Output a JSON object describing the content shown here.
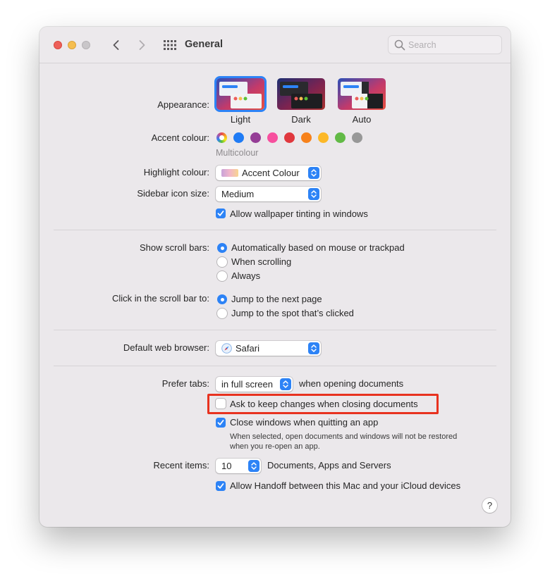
{
  "window": {
    "title": "General",
    "search_placeholder": "Search"
  },
  "appearance": {
    "label": "Appearance:",
    "options": [
      {
        "label": "Light",
        "selected": true
      },
      {
        "label": "Dark",
        "selected": false
      },
      {
        "label": "Auto",
        "selected": false
      }
    ]
  },
  "accent": {
    "label": "Accent colour:",
    "selected_name": "Multicolour",
    "colors": [
      "multicolour",
      "#1f7bf5",
      "#953d96",
      "#f74f9e",
      "#e0383e",
      "#f7821b",
      "#fcb827",
      "#62ba46",
      "#989898"
    ]
  },
  "highlight": {
    "label": "Highlight colour:",
    "value": "Accent Colour"
  },
  "sidebar_icon": {
    "label": "Sidebar icon size:",
    "value": "Medium"
  },
  "wallpaper_tinting": {
    "label": "Allow wallpaper tinting in windows",
    "checked": true
  },
  "scroll_bars": {
    "label": "Show scroll bars:",
    "options": [
      {
        "label": "Automatically based on mouse or trackpad",
        "selected": true
      },
      {
        "label": "When scrolling",
        "selected": false
      },
      {
        "label": "Always",
        "selected": false
      }
    ]
  },
  "scroll_click": {
    "label": "Click in the scroll bar to:",
    "options": [
      {
        "label": "Jump to the next page",
        "selected": true
      },
      {
        "label": "Jump to the spot that’s clicked",
        "selected": false
      }
    ]
  },
  "browser": {
    "label": "Default web browser:",
    "value": "Safari"
  },
  "prefer_tabs": {
    "label": "Prefer tabs:",
    "value": "in full screen",
    "suffix": "when opening documents"
  },
  "ask_keep_changes": {
    "label": "Ask to keep changes when closing documents",
    "checked": false
  },
  "close_windows": {
    "label": "Close windows when quitting an app",
    "checked": true,
    "note_line1": "When selected, open documents and windows will not be restored",
    "note_line2": "when you re-open an app."
  },
  "recent_items": {
    "label": "Recent items:",
    "value": "10",
    "suffix": "Documents, Apps and Servers"
  },
  "handoff": {
    "label": "Allow Handoff between this Mac and your iCloud devices",
    "checked": true
  },
  "help": {
    "label": "?"
  },
  "colors": {
    "accent": "#2d83f6",
    "annotation": "#e8321f"
  }
}
